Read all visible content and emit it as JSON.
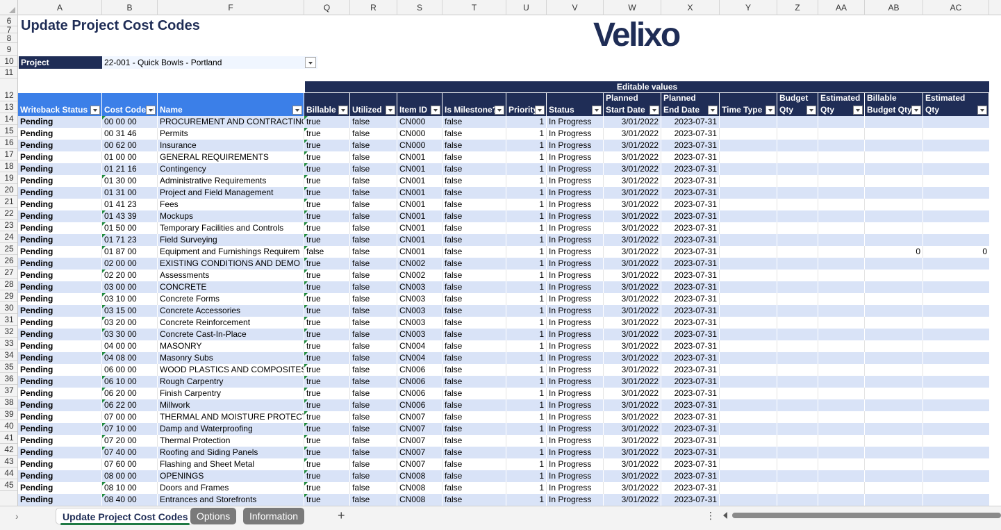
{
  "columns": [
    "A",
    "B",
    "F",
    "Q",
    "R",
    "S",
    "T",
    "U",
    "V",
    "W",
    "X",
    "Y",
    "Z",
    "AA",
    "AB",
    "AC"
  ],
  "row_numbers": [
    "6",
    "7",
    "8",
    "9",
    "10",
    "11",
    "12",
    "13",
    "14",
    "15",
    "16",
    "17",
    "18",
    "19",
    "20",
    "21",
    "22",
    "23",
    "24",
    "25",
    "26",
    "27",
    "28",
    "29",
    "30",
    "31",
    "32",
    "33",
    "34",
    "35",
    "36",
    "37",
    "38",
    "39",
    "40",
    "41",
    "42",
    "43",
    "44",
    "45"
  ],
  "title": "Update Project Cost Codes",
  "logo_text": "Velixo",
  "project": {
    "label": "Project",
    "value": "22-001 - Quick Bowls - Portland"
  },
  "editable_values_label": "Editable values",
  "headers": [
    "Writeback Status",
    "Cost Code",
    "Name",
    "Billable",
    "Utilized",
    "Item ID",
    "Is Milestone?",
    "Priority",
    "Status",
    "Planned Start Date",
    "Planned End Date",
    "Time Type",
    "Budget Qty",
    "Estimated Qty",
    "Billable Budget Qty",
    "Billable Estimated Qty"
  ],
  "rows": [
    [
      "Pending",
      "00 00 00",
      "PROCUREMENT AND CONTRACTING",
      "true",
      "false",
      "CN000",
      "false",
      "1",
      "In Progress",
      "3/01/2022",
      "2023-07-31",
      "",
      "",
      "",
      "",
      ""
    ],
    [
      "Pending",
      "00 31 46",
      "Permits",
      "true",
      "false",
      "CN000",
      "false",
      "1",
      "In Progress",
      "3/01/2022",
      "2023-07-31",
      "",
      "",
      "",
      "",
      ""
    ],
    [
      "Pending",
      "00 62 00",
      "Insurance",
      "true",
      "false",
      "CN000",
      "false",
      "1",
      "In Progress",
      "3/01/2022",
      "2023-07-31",
      "",
      "",
      "",
      "",
      ""
    ],
    [
      "Pending",
      "01 00 00",
      "GENERAL REQUIREMENTS",
      "true",
      "false",
      "CN001",
      "false",
      "1",
      "In Progress",
      "3/01/2022",
      "2023-07-31",
      "",
      "",
      "",
      "",
      ""
    ],
    [
      "Pending",
      "01 21 16",
      "Contingency",
      "true",
      "false",
      "CN001",
      "false",
      "1",
      "In Progress",
      "3/01/2022",
      "2023-07-31",
      "",
      "",
      "",
      "",
      ""
    ],
    [
      "Pending",
      "01 30 00",
      "Administrative Requirements",
      "true",
      "false",
      "CN001",
      "false",
      "1",
      "In Progress",
      "3/01/2022",
      "2023-07-31",
      "",
      "",
      "",
      "",
      ""
    ],
    [
      "Pending",
      "01 31 00",
      "Project and Field Management",
      "true",
      "false",
      "CN001",
      "false",
      "1",
      "In Progress",
      "3/01/2022",
      "2023-07-31",
      "",
      "",
      "",
      "",
      ""
    ],
    [
      "Pending",
      "01 41 23",
      "Fees",
      "true",
      "false",
      "CN001",
      "false",
      "1",
      "In Progress",
      "3/01/2022",
      "2023-07-31",
      "",
      "",
      "",
      "",
      ""
    ],
    [
      "Pending",
      "01 43 39",
      "Mockups",
      "true",
      "false",
      "CN001",
      "false",
      "1",
      "In Progress",
      "3/01/2022",
      "2023-07-31",
      "",
      "",
      "",
      "",
      ""
    ],
    [
      "Pending",
      "01 50 00",
      "Temporary Facilities and Controls",
      "true",
      "false",
      "CN001",
      "false",
      "1",
      "In Progress",
      "3/01/2022",
      "2023-07-31",
      "",
      "",
      "",
      "",
      ""
    ],
    [
      "Pending",
      "01 71 23",
      "Field Surveying",
      "true",
      "false",
      "CN001",
      "false",
      "1",
      "In Progress",
      "3/01/2022",
      "2023-07-31",
      "",
      "",
      "",
      "",
      ""
    ],
    [
      "Pending",
      "01 87 00",
      "Equipment and Furnishings Requirem",
      "false",
      "false",
      "CN001",
      "false",
      "1",
      "In Progress",
      "3/01/2022",
      "2023-07-31",
      "",
      "",
      "",
      "0",
      "0"
    ],
    [
      "Pending",
      "02 00 00",
      "EXISTING CONDITIONS AND DEMO",
      "true",
      "false",
      "CN002",
      "false",
      "1",
      "In Progress",
      "3/01/2022",
      "2023-07-31",
      "",
      "",
      "",
      "",
      ""
    ],
    [
      "Pending",
      "02 20 00",
      "Assessments",
      "true",
      "false",
      "CN002",
      "false",
      "1",
      "In Progress",
      "3/01/2022",
      "2023-07-31",
      "",
      "",
      "",
      "",
      ""
    ],
    [
      "Pending",
      "03 00 00",
      "CONCRETE",
      "true",
      "false",
      "CN003",
      "false",
      "1",
      "In Progress",
      "3/01/2022",
      "2023-07-31",
      "",
      "",
      "",
      "",
      ""
    ],
    [
      "Pending",
      "03 10 00",
      "Concrete Forms",
      "true",
      "false",
      "CN003",
      "false",
      "1",
      "In Progress",
      "3/01/2022",
      "2023-07-31",
      "",
      "",
      "",
      "",
      ""
    ],
    [
      "Pending",
      "03 15 00",
      "Concrete Accessories",
      "true",
      "false",
      "CN003",
      "false",
      "1",
      "In Progress",
      "3/01/2022",
      "2023-07-31",
      "",
      "",
      "",
      "",
      ""
    ],
    [
      "Pending",
      "03 20 00",
      "Concrete Reinforcement",
      "true",
      "false",
      "CN003",
      "false",
      "1",
      "In Progress",
      "3/01/2022",
      "2023-07-31",
      "",
      "",
      "",
      "",
      ""
    ],
    [
      "Pending",
      "03 30 00",
      "Concrete Cast-In-Place",
      "true",
      "false",
      "CN003",
      "false",
      "1",
      "In Progress",
      "3/01/2022",
      "2023-07-31",
      "",
      "",
      "",
      "",
      ""
    ],
    [
      "Pending",
      "04 00 00",
      "MASONRY",
      "true",
      "false",
      "CN004",
      "false",
      "1",
      "In Progress",
      "3/01/2022",
      "2023-07-31",
      "",
      "",
      "",
      "",
      ""
    ],
    [
      "Pending",
      "04 08 00",
      "Masonry Subs",
      "true",
      "false",
      "CN004",
      "false",
      "1",
      "In Progress",
      "3/01/2022",
      "2023-07-31",
      "",
      "",
      "",
      "",
      ""
    ],
    [
      "Pending",
      "06 00 00",
      "WOOD PLASTICS AND COMPOSITES",
      "true",
      "false",
      "CN006",
      "false",
      "1",
      "In Progress",
      "3/01/2022",
      "2023-07-31",
      "",
      "",
      "",
      "",
      ""
    ],
    [
      "Pending",
      "06 10 00",
      "Rough Carpentry",
      "true",
      "false",
      "CN006",
      "false",
      "1",
      "In Progress",
      "3/01/2022",
      "2023-07-31",
      "",
      "",
      "",
      "",
      ""
    ],
    [
      "Pending",
      "06 20 00",
      "Finish Carpentry",
      "true",
      "false",
      "CN006",
      "false",
      "1",
      "In Progress",
      "3/01/2022",
      "2023-07-31",
      "",
      "",
      "",
      "",
      ""
    ],
    [
      "Pending",
      "06 22 00",
      "Millwork",
      "true",
      "false",
      "CN006",
      "false",
      "1",
      "In Progress",
      "3/01/2022",
      "2023-07-31",
      "",
      "",
      "",
      "",
      ""
    ],
    [
      "Pending",
      "07 00 00",
      "THERMAL AND MOISTURE PROTECTI",
      "true",
      "false",
      "CN007",
      "false",
      "1",
      "In Progress",
      "3/01/2022",
      "2023-07-31",
      "",
      "",
      "",
      "",
      ""
    ],
    [
      "Pending",
      "07 10 00",
      "Damp and Waterproofing",
      "true",
      "false",
      "CN007",
      "false",
      "1",
      "In Progress",
      "3/01/2022",
      "2023-07-31",
      "",
      "",
      "",
      "",
      ""
    ],
    [
      "Pending",
      "07 20 00",
      "Thermal Protection",
      "true",
      "false",
      "CN007",
      "false",
      "1",
      "In Progress",
      "3/01/2022",
      "2023-07-31",
      "",
      "",
      "",
      "",
      ""
    ],
    [
      "Pending",
      "07 40 00",
      "Roofing and Siding Panels",
      "true",
      "false",
      "CN007",
      "false",
      "1",
      "In Progress",
      "3/01/2022",
      "2023-07-31",
      "",
      "",
      "",
      "",
      ""
    ],
    [
      "Pending",
      "07 60 00",
      "Flashing and Sheet Metal",
      "true",
      "false",
      "CN007",
      "false",
      "1",
      "In Progress",
      "3/01/2022",
      "2023-07-31",
      "",
      "",
      "",
      "",
      ""
    ],
    [
      "Pending",
      "08 00 00",
      "OPENINGS",
      "true",
      "false",
      "CN008",
      "false",
      "1",
      "In Progress",
      "3/01/2022",
      "2023-07-31",
      "",
      "",
      "",
      "",
      ""
    ],
    [
      "Pending",
      "08 10 00",
      "Doors and Frames",
      "true",
      "false",
      "CN008",
      "false",
      "1",
      "In Progress",
      "3/01/2022",
      "2023-07-31",
      "",
      "",
      "",
      "",
      ""
    ],
    [
      "Pending",
      "08 40 00",
      "Entrances and Storefronts",
      "true",
      "false",
      "CN008",
      "false",
      "1",
      "In Progress",
      "3/01/2022",
      "2023-07-31",
      "",
      "",
      "",
      "",
      ""
    ]
  ],
  "sheet_tabs": [
    "Update Project Cost Codes",
    "Options",
    "Information"
  ],
  "active_tab": "Update Project Cost Codes",
  "colors": {
    "navy": "#1f2d56",
    "header_blue": "#3b7fe8",
    "band": "#d9e3f7",
    "comment_flag": "#1e8a3c"
  },
  "icons": {
    "filter": "filter-dropdown-icon",
    "add_sheet": "plus-icon",
    "more": "more-options-icon"
  }
}
